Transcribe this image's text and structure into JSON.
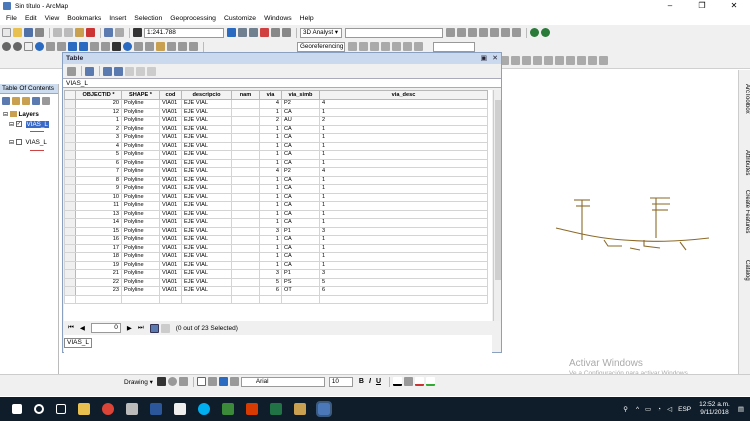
{
  "window": {
    "title": "Sin título - ArcMap",
    "minimize": "–",
    "maximize": "❐",
    "close": "✕"
  },
  "menu": [
    "File",
    "Edit",
    "View",
    "Bookmarks",
    "Insert",
    "Selection",
    "Geoprocessing",
    "Customize",
    "Windows",
    "Help"
  ],
  "toolbar": {
    "scale": "1:241.788",
    "analyst": "3D Analyst ▾",
    "georef": "Georeferencing ▾"
  },
  "toc": {
    "title": "Table Of Contents",
    "layers_label": "Layers",
    "layer1": "VIAS_L",
    "layer2": "VIAS_L"
  },
  "table_window": {
    "title": "Table",
    "tab": "VIAS_L",
    "columns": [
      "OBJECTID *",
      "SHAPE *",
      "cod",
      "descripcio",
      "nam",
      "via",
      "via_simb",
      "via_desc"
    ],
    "rows": [
      [
        "20",
        "Polyline",
        "VIA01",
        "EJE VIAL",
        "",
        "4",
        "P2",
        "4"
      ],
      [
        "12",
        "Polyline",
        "VIA01",
        "EJE VIAL",
        "",
        "1",
        "CA",
        "1"
      ],
      [
        "1",
        "Polyline",
        "VIA01",
        "EJE VIAL",
        "",
        "2",
        "AU",
        "2"
      ],
      [
        "2",
        "Polyline",
        "VIA01",
        "EJE VIAL",
        "",
        "1",
        "CA",
        "1"
      ],
      [
        "3",
        "Polyline",
        "VIA01",
        "EJE VIAL",
        "",
        "1",
        "CA",
        "1"
      ],
      [
        "4",
        "Polyline",
        "VIA01",
        "EJE VIAL",
        "",
        "1",
        "CA",
        "1"
      ],
      [
        "5",
        "Polyline",
        "VIA01",
        "EJE VIAL",
        "",
        "1",
        "CA",
        "1"
      ],
      [
        "6",
        "Polyline",
        "VIA01",
        "EJE VIAL",
        "",
        "1",
        "CA",
        "1"
      ],
      [
        "7",
        "Polyline",
        "VIA01",
        "EJE VIAL",
        "",
        "4",
        "P2",
        "4"
      ],
      [
        "8",
        "Polyline",
        "VIA01",
        "EJE VIAL",
        "",
        "1",
        "CA",
        "1"
      ],
      [
        "9",
        "Polyline",
        "VIA01",
        "EJE VIAL",
        "",
        "1",
        "CA",
        "1"
      ],
      [
        "10",
        "Polyline",
        "VIA01",
        "EJE VIAL",
        "",
        "1",
        "CA",
        "1"
      ],
      [
        "11",
        "Polyline",
        "VIA01",
        "EJE VIAL",
        "",
        "1",
        "CA",
        "1"
      ],
      [
        "13",
        "Polyline",
        "VIA01",
        "EJE VIAL",
        "",
        "1",
        "CA",
        "1"
      ],
      [
        "14",
        "Polyline",
        "VIA01",
        "EJE VIAL",
        "",
        "1",
        "CA",
        "1"
      ],
      [
        "15",
        "Polyline",
        "VIA01",
        "EJE VIAL",
        "",
        "3",
        "P1",
        "3"
      ],
      [
        "16",
        "Polyline",
        "VIA01",
        "EJE VIAL",
        "",
        "1",
        "CA",
        "1"
      ],
      [
        "17",
        "Polyline",
        "VIA01",
        "EJE VIAL",
        "",
        "1",
        "CA",
        "1"
      ],
      [
        "18",
        "Polyline",
        "VIA01",
        "EJE VIAL",
        "",
        "1",
        "CA",
        "1"
      ],
      [
        "19",
        "Polyline",
        "VIA01",
        "EJE VIAL",
        "",
        "1",
        "CA",
        "1"
      ],
      [
        "21",
        "Polyline",
        "VIA01",
        "EJE VIAL",
        "",
        "3",
        "P1",
        "3"
      ],
      [
        "22",
        "Polyline",
        "VIA01",
        "EJE VIAL",
        "",
        "5",
        "PS",
        "5"
      ],
      [
        "23",
        "Polyline",
        "VIA01",
        "EJE VIAL",
        "",
        "6",
        "OT",
        "6"
      ]
    ],
    "record_value": "0",
    "selection_status": "(0 out of 23 Selected)",
    "bottom_tab": "VIAS_L"
  },
  "right_dock": {
    "tab1": "ArcToolbox",
    "tab2": "Attributes",
    "tab3": "Create Features",
    "tab4": "Catalog"
  },
  "watermark": {
    "line1": "Activar Windows",
    "line2": "Ve a Configuración para activar Windows."
  },
  "drawing": {
    "label": "Drawing ▾",
    "font": "Arial",
    "size": "10",
    "bold": "B",
    "italic": "I",
    "underline": "U"
  },
  "taskbar": {
    "lang": "ESP",
    "time": "12:52 a.m.",
    "date": "9/11/2018"
  },
  "colors": {
    "road_line": "#8b6a2a",
    "toc_header": "#cddcef",
    "taskbar": "#0f1d2b"
  }
}
